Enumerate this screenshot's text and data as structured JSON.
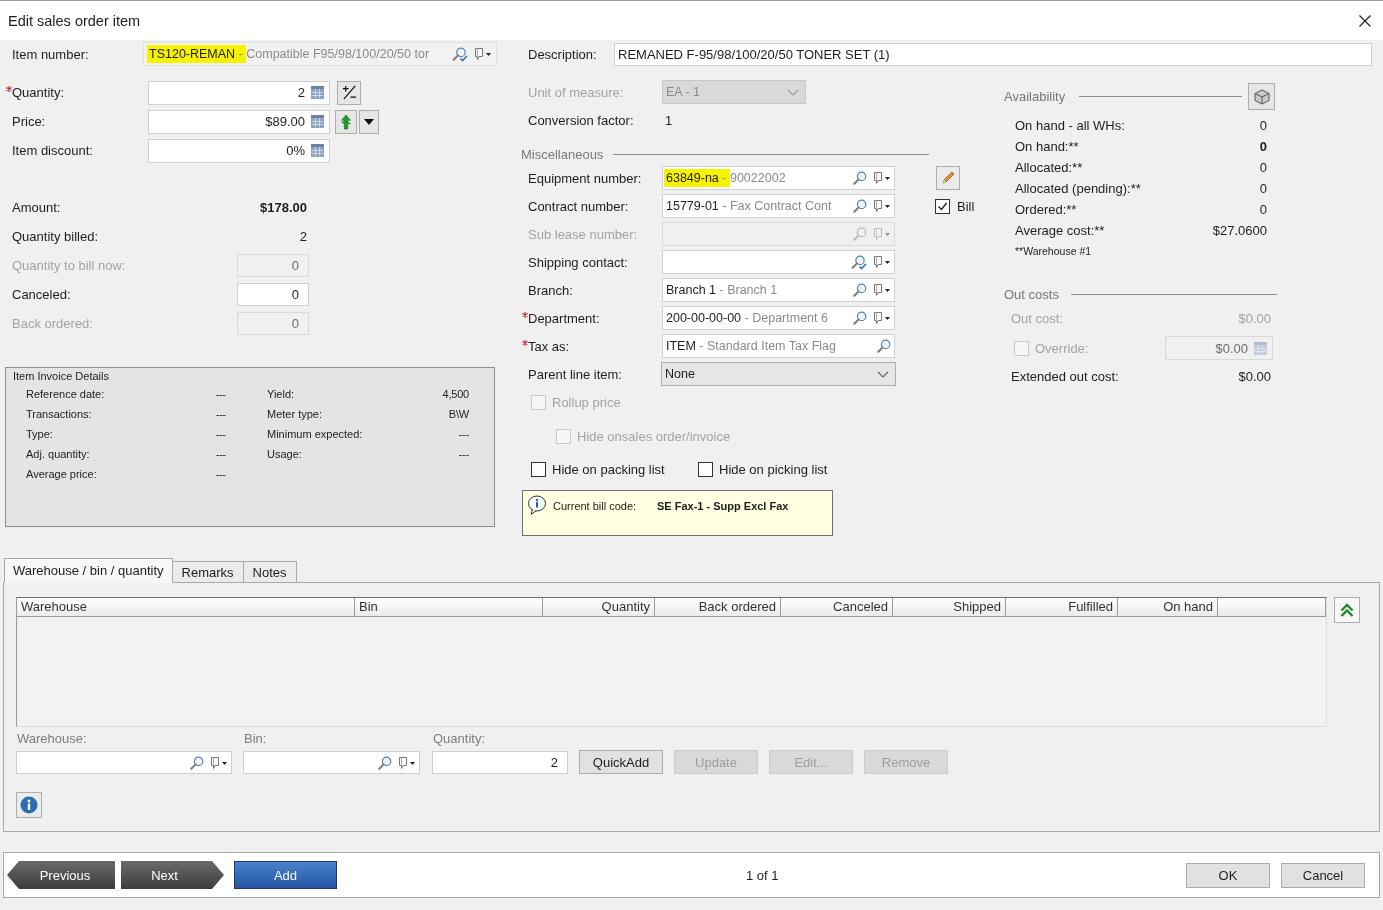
{
  "window": {
    "title": "Edit sales order item"
  },
  "item_number": {
    "label": "Item number:",
    "code": "TS120-REMAN",
    "separator": "-",
    "description": "Compatible F95/98/100/20/50 tor",
    "highlighted": true
  },
  "description": {
    "label": "Description:",
    "value": "REMANED F-95/98/100/20/50 TONER SET (1)"
  },
  "entry_fields": [
    {
      "label": "Quantity:",
      "value": "2",
      "required": true,
      "kind": "adjust"
    },
    {
      "label": "Price:",
      "value": "$89.00",
      "required": false,
      "kind": "price"
    },
    {
      "label": "Item discount:",
      "value": "0%",
      "required": false,
      "kind": "plain"
    }
  ],
  "totals": [
    {
      "label": "Amount:",
      "value": "$178.00",
      "kind": "total",
      "disabled": false
    },
    {
      "label": "Quantity billed:",
      "value": "2",
      "kind": "text",
      "disabled": false
    },
    {
      "label": "Quantity to bill now:",
      "value": "0",
      "kind": "field",
      "disabled": true
    },
    {
      "label": "Canceled:",
      "value": "0",
      "kind": "field",
      "disabled": false
    },
    {
      "label": "Back ordered:",
      "value": "0",
      "kind": "field",
      "disabled": true
    }
  ],
  "invoice_details": {
    "title": "Item Invoice Details",
    "left": [
      {
        "label": "Reference date:",
        "value": "---"
      },
      {
        "label": "Transactions:",
        "value": "---"
      },
      {
        "label": "Type:",
        "value": "---"
      },
      {
        "label": "Adj. quantity:",
        "value": "---"
      },
      {
        "label": "Average price:",
        "value": "---"
      }
    ],
    "right": [
      {
        "label": "Yield:",
        "value": "4,500"
      },
      {
        "label": "Meter type:",
        "value": "B\\W"
      },
      {
        "label": "Minimum expected:",
        "value": "---"
      },
      {
        "label": "Usage:",
        "value": "---"
      }
    ]
  },
  "unit_of_measure": {
    "label": "Unit of measure:",
    "value": "EA - 1",
    "disabled": true
  },
  "conversion_factor": {
    "label": "Conversion factor:",
    "value": "1"
  },
  "miscellaneous": {
    "title": "Miscellaneous",
    "fields": [
      {
        "label": "Equipment number:",
        "code": "63849-na",
        "separator": "-",
        "description": "90022002",
        "kind": "lookup",
        "required": false,
        "disabled": false,
        "highlighted": true
      },
      {
        "label": "Contract number:",
        "code": "15779-01",
        "separator": "-",
        "description": "Fax Contract Cont",
        "kind": "lookup",
        "required": false,
        "disabled": false,
        "highlighted": false
      },
      {
        "label": "Sub lease number:",
        "kind": "lookup",
        "required": false,
        "disabled": true,
        "highlighted": false
      },
      {
        "label": "Shipping contact:",
        "kind": "contact",
        "required": false,
        "disabled": false,
        "highlighted": false
      },
      {
        "label": "Branch:",
        "code": "Branch 1",
        "separator": "-",
        "description": "Branch 1",
        "kind": "lookup",
        "required": false,
        "disabled": false,
        "highlighted": false
      },
      {
        "label": "Department:",
        "code": "200-00-00-00",
        "separator": "-",
        "description": "Department 6",
        "kind": "lookup",
        "required": true,
        "disabled": false,
        "highlighted": false
      },
      {
        "label": "Tax as:",
        "code": "ITEM",
        "separator": "-",
        "description": "Standard Item Tax Flag",
        "kind": "search",
        "required": true,
        "disabled": false,
        "highlighted": false
      }
    ],
    "bill": {
      "label": "Bill",
      "checked": true
    },
    "parent_line_item": {
      "label": "Parent line item:",
      "value": "None"
    },
    "options": [
      {
        "label": "Rollup price",
        "checked": false,
        "disabled": true,
        "children": [
          {
            "label": "Hide onsales order/invoice",
            "checked": false,
            "disabled": true
          }
        ]
      }
    ],
    "list_options": [
      {
        "label": "Hide on packing list",
        "checked": false,
        "disabled": false
      },
      {
        "label": "Hide on picking list",
        "checked": false,
        "disabled": false
      }
    ],
    "bill_code": {
      "label": "Current bill code:",
      "value": "SE Fax-1 - Supp Excl Fax"
    }
  },
  "availability": {
    "title": "Availability",
    "rows": [
      {
        "label": "On hand - all WHs:",
        "value": "0",
        "bold": false
      },
      {
        "label": "On hand:**",
        "value": "0",
        "bold": true
      },
      {
        "label": "Allocated:**",
        "value": "0",
        "bold": false
      },
      {
        "label": "Allocated (pending):**",
        "value": "0",
        "bold": false
      },
      {
        "label": "Ordered:**",
        "value": "0",
        "bold": false
      },
      {
        "label": "Average cost:**",
        "value": "$27.0600",
        "bold": false
      }
    ],
    "footnote": "**Warehouse #1"
  },
  "out_costs": {
    "title": "Out costs",
    "out_cost": {
      "label": "Out cost:",
      "value": "$0.00",
      "disabled": true
    },
    "override": {
      "label": "Override:",
      "value": "$0.00",
      "checked": false,
      "disabled": true
    },
    "extended": {
      "label": "Extended out cost:",
      "value": "$0.00"
    }
  },
  "tabs": [
    {
      "label": "Warehouse / bin / quantity",
      "selected": true
    },
    {
      "label": "Remarks",
      "selected": false
    },
    {
      "label": "Notes",
      "selected": false
    }
  ],
  "table": {
    "columns": [
      {
        "label": "Warehouse",
        "kind": "text"
      },
      {
        "label": "Bin",
        "kind": "text"
      },
      {
        "label": "Quantity",
        "kind": "number"
      },
      {
        "label": "Back ordered",
        "kind": "number"
      },
      {
        "label": "Canceled",
        "kind": "number"
      },
      {
        "label": "Shipped",
        "kind": "number"
      },
      {
        "label": "Fulfilled",
        "kind": "number"
      },
      {
        "label": "On hand",
        "kind": "number"
      }
    ]
  },
  "entry": {
    "fields": [
      {
        "label": "Warehouse:",
        "kind": "lookup"
      },
      {
        "label": "Bin:",
        "kind": "lookup"
      },
      {
        "label": "Quantity:",
        "kind": "number",
        "value": "2"
      }
    ],
    "buttons": [
      {
        "label": "QuickAdd",
        "disabled": false
      },
      {
        "label": "Update",
        "disabled": true
      },
      {
        "label": "Edit...",
        "disabled": true
      },
      {
        "label": "Remove",
        "disabled": true
      }
    ]
  },
  "footer": {
    "nav": [
      {
        "label": "Previous",
        "kind": "back"
      },
      {
        "label": "Next",
        "kind": "forward"
      },
      {
        "label": "Add",
        "kind": "primary"
      }
    ],
    "page": "1 of 1",
    "buttons": [
      "OK",
      "Cancel"
    ]
  }
}
